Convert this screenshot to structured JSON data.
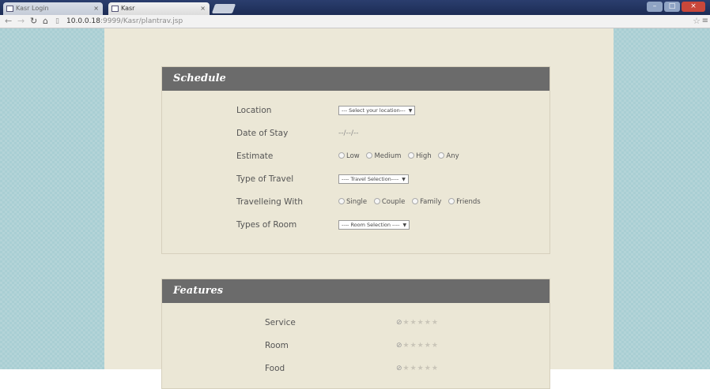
{
  "browser": {
    "tabs": [
      {
        "title": "Kasr Login"
      },
      {
        "title": "Kasr"
      }
    ],
    "url_host": "10.0.0.18",
    "url_path": ":9999/Kasr/plantrav.jsp"
  },
  "schedule": {
    "heading": "Schedule",
    "rows": [
      {
        "label": "Location"
      },
      {
        "label": "Date of Stay"
      },
      {
        "label": "Estimate"
      },
      {
        "label": "Type of Travel"
      },
      {
        "label": "Travelleing With"
      },
      {
        "label": "Types of Room"
      }
    ],
    "location_select": "--- Select your location---",
    "date_placeholder": "--/--/--",
    "estimate_options": [
      "Low",
      "Medium",
      "High",
      "Any"
    ],
    "travel_select": "---- Travel Selection----",
    "with_options": [
      "Single",
      "Couple",
      "Family",
      "Friends"
    ],
    "room_select": "---- Room Selection ----"
  },
  "features": {
    "heading": "Features",
    "rows": [
      {
        "label": "Service"
      },
      {
        "label": "Room"
      },
      {
        "label": "Food"
      }
    ]
  },
  "colors": {
    "panel_header": "#6b6b6b",
    "page_bg": "#a9ced3",
    "column_bg": "#ece8d8"
  },
  "icons": [
    "back-icon",
    "forward-icon",
    "reload-icon",
    "home-icon",
    "page-icon",
    "star-icon",
    "menu-icon",
    "cancel-rating-icon",
    "star-rating-icon"
  ]
}
